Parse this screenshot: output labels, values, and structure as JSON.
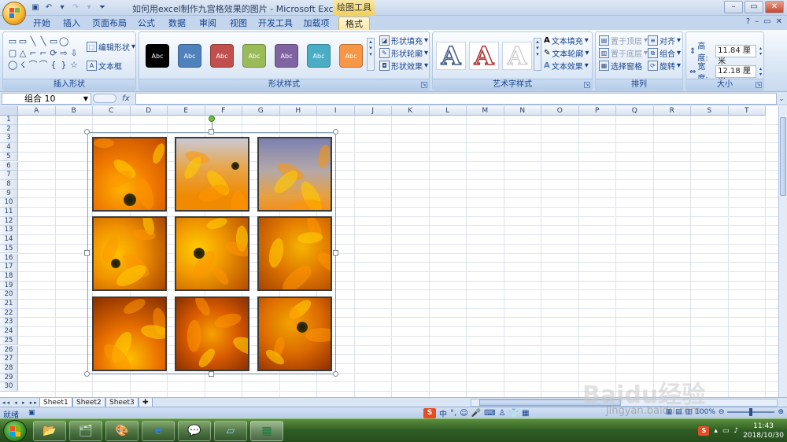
{
  "window": {
    "title": "如何用excel制作九宫格效果的图片 - Microsoft Excel",
    "context_tool": "绘图工具",
    "minimize": "–",
    "restore": "▭",
    "close": "✕"
  },
  "tabs": [
    {
      "label": "开始"
    },
    {
      "label": "插入"
    },
    {
      "label": "页面布局"
    },
    {
      "label": "公式"
    },
    {
      "label": "数据"
    },
    {
      "label": "审阅"
    },
    {
      "label": "视图"
    },
    {
      "label": "开发工具"
    },
    {
      "label": "加载项"
    },
    {
      "label": "格式",
      "active": true
    }
  ],
  "ribbon": {
    "insert_shapes": {
      "label": "插入形状",
      "edit_shape": "编辑形状",
      "text_box": "文本框",
      "shape_glyphs": [
        "▭",
        "▭",
        "╲",
        "╲",
        "▭",
        "◯",
        "",
        "▢",
        "△",
        "⌐",
        "⌐",
        "⟳",
        "⇨",
        "⇩",
        "◯",
        "☇",
        "⌒",
        "⌒",
        "{",
        "}",
        "☆"
      ]
    },
    "shape_styles": {
      "label": "形状样式",
      "swatch_text": "Abc",
      "swatches": [
        "#000000",
        "#4f81bd",
        "#c0504d",
        "#9bbb59",
        "#8064a2",
        "#4bacc6",
        "#f79646"
      ],
      "fill": "形状填充",
      "outline": "形状轮廓",
      "effects": "形状效果"
    },
    "wordart": {
      "label": "艺术字样式",
      "letter": "A",
      "text_fill": "文本填充",
      "text_outline": "文本轮廓",
      "text_effects": "文本效果"
    },
    "arrange": {
      "label": "排列",
      "bring_front": "置于顶层",
      "send_back": "置于底层",
      "selection_pane": "选择窗格",
      "align": "对齐",
      "group": "组合",
      "rotate": "旋转"
    },
    "size": {
      "label": "大小",
      "height_label": "高度:",
      "height_value": "11.84 厘米",
      "width_label": "宽度:",
      "width_value": "12.18 厘米"
    }
  },
  "formula_bar": {
    "name_box": "组合 10",
    "fx": "fx",
    "content": ""
  },
  "columns": [
    "A",
    "B",
    "C",
    "D",
    "E",
    "F",
    "G",
    "H",
    "I",
    "J",
    "K",
    "L",
    "M",
    "N",
    "O",
    "P",
    "Q",
    "R",
    "S",
    "T"
  ],
  "rows": [
    "1",
    "2",
    "3",
    "4",
    "5",
    "6",
    "7",
    "8",
    "9",
    "10",
    "11",
    "12",
    "13",
    "14",
    "15",
    "16",
    "17",
    "18",
    "19",
    "20",
    "21",
    "22",
    "23",
    "24",
    "25",
    "26",
    "27",
    "28",
    "29",
    "30"
  ],
  "sheets": [
    {
      "label": "Sheet1",
      "active": true
    },
    {
      "label": "Sheet2"
    },
    {
      "label": "Sheet3"
    }
  ],
  "status": {
    "ready": "就绪",
    "ime_brand": "S",
    "ime_mode": "中",
    "zoom": "100%"
  },
  "taskbar": {
    "apps": [
      "folder-app-icon",
      "explorer-icon",
      "paint-icon",
      "ie-icon",
      "wechat-icon",
      "notepad-icon",
      "excel-icon"
    ],
    "time": "11:43",
    "date": "2018/10/30"
  },
  "watermark": {
    "text": "Baidu经验",
    "url": "jingyan.baidu.com"
  },
  "colors": {
    "ribbon_bg": "#dbe6f4",
    "accent": "#15428b",
    "taskbar": "#2f5c24",
    "flower_orange": "#f28a00",
    "flower_yellow": "#f7b500"
  }
}
